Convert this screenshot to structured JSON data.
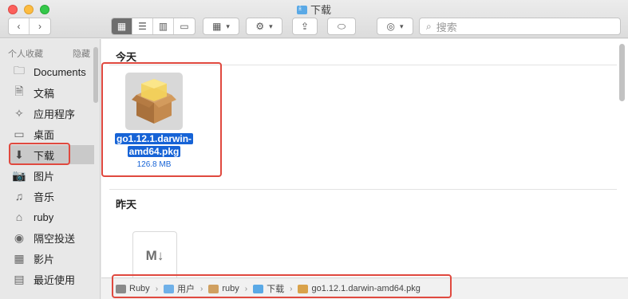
{
  "window": {
    "title": "下载"
  },
  "toolbar": {
    "back_icon": "chevron-left-icon",
    "forward_icon": "chevron-right-icon",
    "view_modes": [
      "icon-view-icon",
      "list-view-icon",
      "column-view-icon",
      "gallery-view-icon"
    ],
    "search_placeholder": "搜索"
  },
  "sidebar": {
    "header": "个人收藏",
    "hide_label": "隐藏",
    "items": [
      {
        "label": "Documents",
        "icon": "folder-icon"
      },
      {
        "label": "文稿",
        "icon": "document-icon"
      },
      {
        "label": "应用程序",
        "icon": "applications-icon"
      },
      {
        "label": "桌面",
        "icon": "desktop-icon"
      },
      {
        "label": "下载",
        "icon": "downloads-icon",
        "selected": true
      },
      {
        "label": "图片",
        "icon": "camera-icon"
      },
      {
        "label": "音乐",
        "icon": "music-note-icon"
      },
      {
        "label": "ruby",
        "icon": "home-icon"
      },
      {
        "label": "隔空投送",
        "icon": "airdrop-icon"
      },
      {
        "label": "影片",
        "icon": "film-icon"
      },
      {
        "label": "最近使用",
        "icon": "recents-icon"
      }
    ]
  },
  "content": {
    "today_label": "今天",
    "yesterday_label": "昨天",
    "pkg_file": {
      "name_line1": "go1.12.1.darwin-",
      "name_line2": "amd64.pkg",
      "size": "126.8 MB"
    },
    "md_file": {
      "badge": "M↓"
    }
  },
  "pathbar": {
    "crumbs": [
      "Ruby",
      "用户",
      "ruby",
      "下载",
      "go1.12.1.darwin-amd64.pkg"
    ],
    "separator": "›"
  },
  "colors": {
    "selection": "#1663d6",
    "highlight": "#e0493f"
  }
}
